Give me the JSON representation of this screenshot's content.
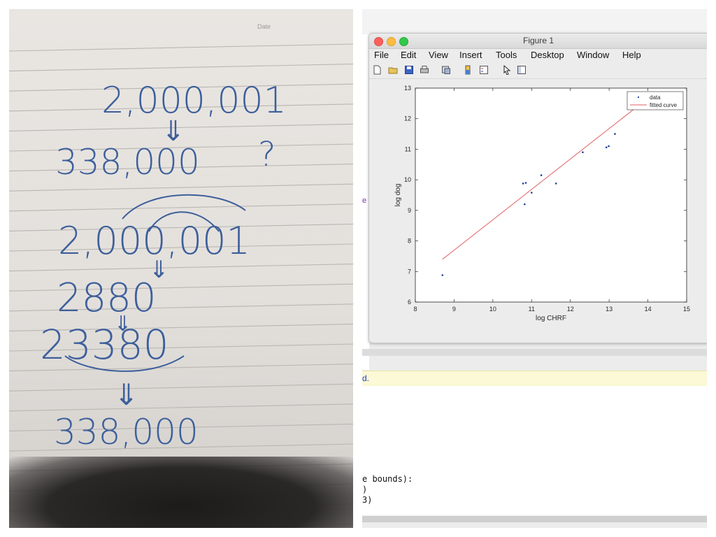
{
  "notebook": {
    "header_field": "Date",
    "handwriting": {
      "line1": "2,000,001",
      "line2": "338,000",
      "question_mark": "?",
      "line3": "2,000,001",
      "line4": "2880",
      "line5": "23380",
      "line6": "338,000",
      "implies": "⇓"
    }
  },
  "matlab": {
    "workspace_fragment": "e",
    "figure": {
      "window_title": "Figure 1",
      "menus": [
        "File",
        "Edit",
        "View",
        "Insert",
        "Tools",
        "Desktop",
        "Window",
        "Help"
      ],
      "toolbar_icons": [
        "new-figure-icon",
        "open-file-icon",
        "save-icon",
        "print-icon",
        "link-plot-icon",
        "insert-colorbar-icon",
        "insert-legend-icon",
        "edit-plot-pointer-icon",
        "property-inspector-icon"
      ]
    },
    "chart_data": {
      "type": "scatter",
      "title": "",
      "xlabel": "log CHRF",
      "ylabel": "log dog",
      "xlim": [
        8,
        15
      ],
      "ylim": [
        6,
        13
      ],
      "xticks": [
        8,
        9,
        10,
        11,
        12,
        13,
        14,
        15
      ],
      "yticks": [
        6,
        7,
        8,
        9,
        10,
        11,
        12,
        13
      ],
      "grid": false,
      "legend_position": "top-right",
      "series": [
        {
          "name": "data",
          "mode": "markers",
          "color": "#1f3b9e",
          "x": [
            8.7,
            10.78,
            10.82,
            10.85,
            11.0,
            11.25,
            11.63,
            12.32,
            12.93,
            12.99,
            13.15
          ],
          "y": [
            6.88,
            9.88,
            9.2,
            9.9,
            9.58,
            10.15,
            9.88,
            10.9,
            11.06,
            11.1,
            11.5
          ]
        },
        {
          "name": "fitted curve",
          "mode": "line",
          "color": "#e06060",
          "x": [
            8.7,
            13.78
          ],
          "y": [
            7.4,
            12.45
          ]
        }
      ]
    },
    "command_window": {
      "status_fragment": "d.",
      "lines": [
        "e bounds):",
        ")",
        "3)"
      ]
    }
  }
}
